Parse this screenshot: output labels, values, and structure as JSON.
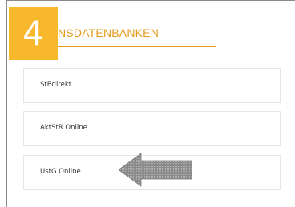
{
  "step": {
    "number": "4"
  },
  "section": {
    "title": "NSDATENBANKEN"
  },
  "databases": [
    {
      "label": "StBdirekt"
    },
    {
      "label": "AktStR Online"
    },
    {
      "label": "UstG Online"
    }
  ],
  "annotation": {
    "arrow_icon": "left-arrow-icon",
    "arrow_color": "#8c8c8c"
  },
  "colors": {
    "accent": "#f7b82b",
    "title": "#e49a18"
  }
}
